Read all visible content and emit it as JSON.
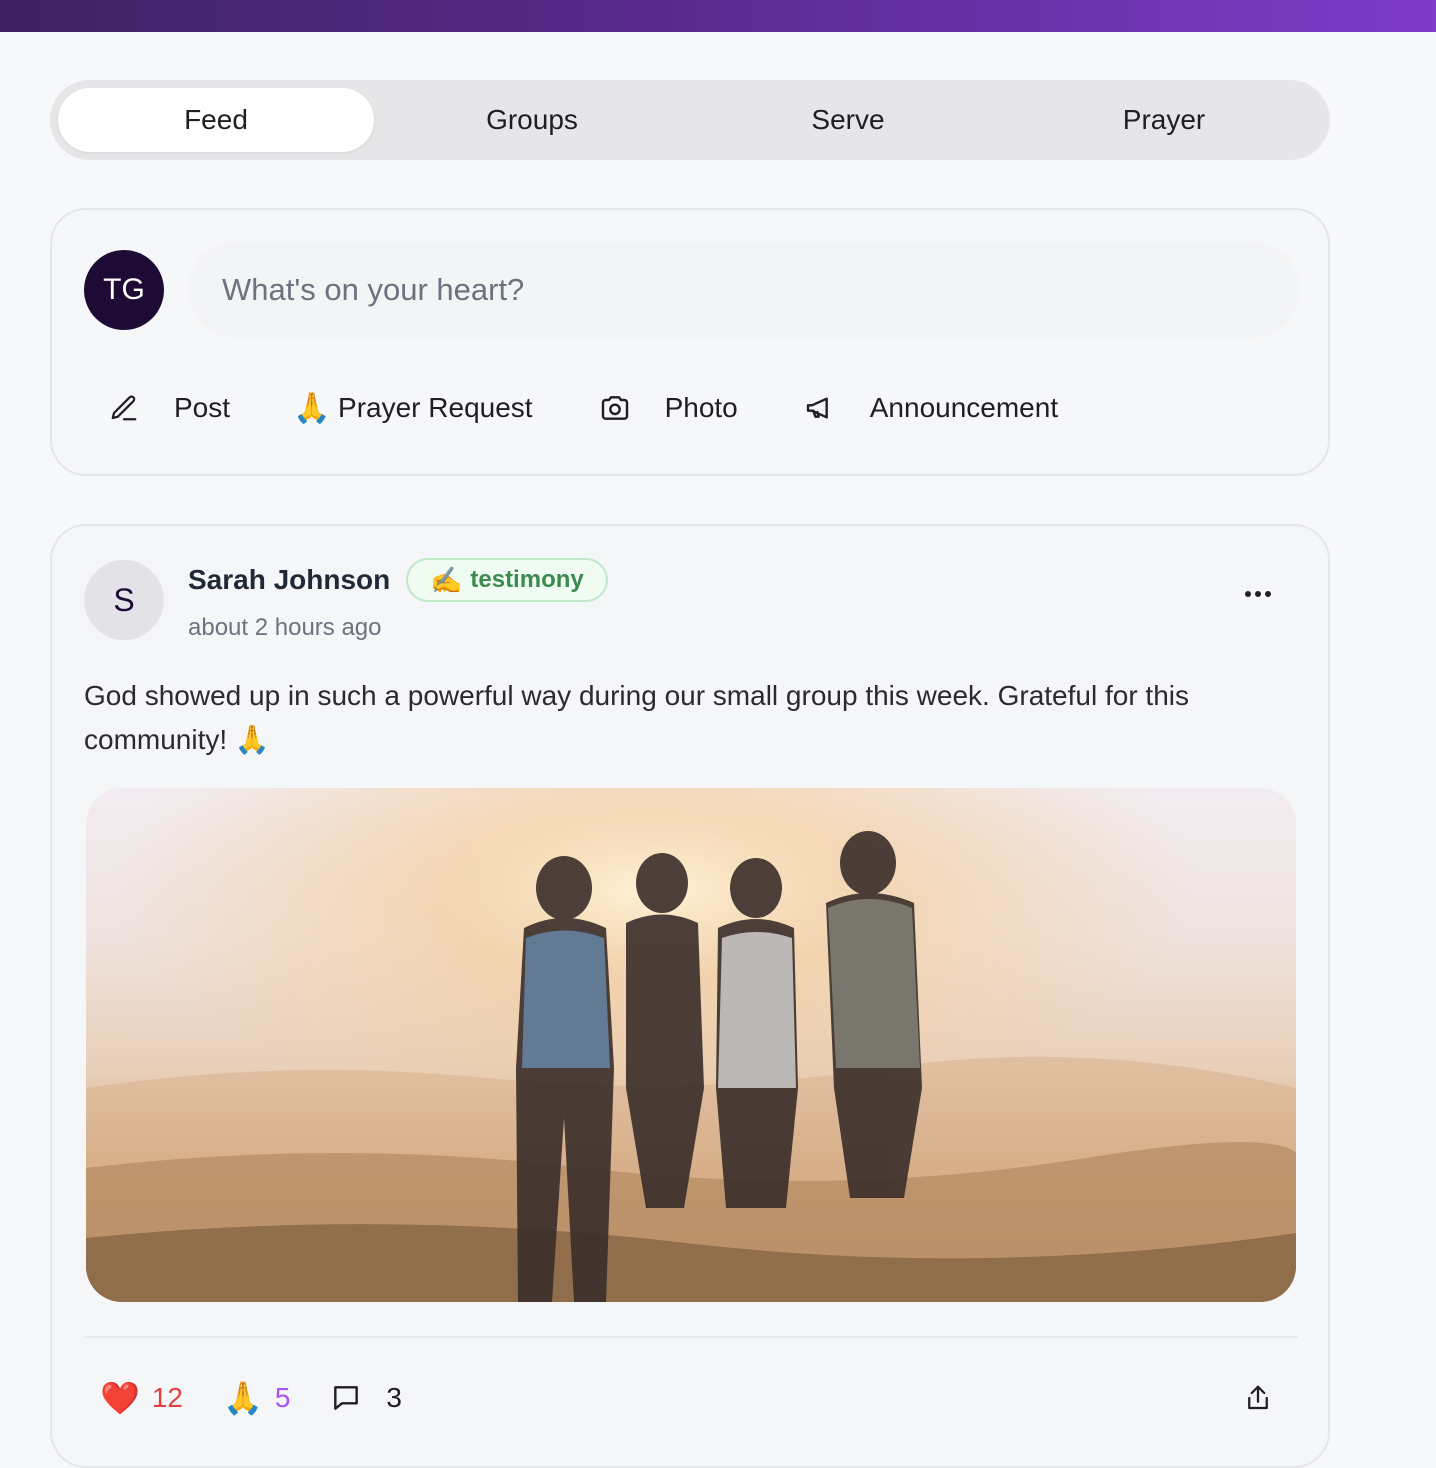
{
  "tabs": [
    "Feed",
    "Groups",
    "Serve",
    "Prayer"
  ],
  "active_tab": "Feed",
  "composer": {
    "avatar_initials": "TG",
    "placeholder": "What's on your heart?",
    "actions": [
      {
        "icon": "pencil-icon",
        "label": "Post"
      },
      {
        "icon": "🙏",
        "label": "Prayer Request"
      },
      {
        "icon": "camera-icon",
        "label": "Photo"
      },
      {
        "icon": "megaphone-icon",
        "label": "Announcement"
      }
    ]
  },
  "post": {
    "avatar_initial": "S",
    "author": "Sarah Johnson",
    "badge_icon": "✍️",
    "badge_label": "testimony",
    "time": "about 2 hours ago",
    "text": "God showed up in such a powerful way during our small group this week. Grateful for this community! 🙏",
    "reactions": {
      "heart_icon": "❤️",
      "hearts": "12",
      "pray_icon": "🙏",
      "prayers": "5",
      "comments": "3"
    }
  },
  "colors": {
    "brand_gradient_start": "#3e2262",
    "brand_gradient_end": "#7d3cc9",
    "avatar_dark": "#1e0b35",
    "heart_count": "#e0433f",
    "pray_count": "#a855f7",
    "badge_text": "#3b8a4e"
  }
}
